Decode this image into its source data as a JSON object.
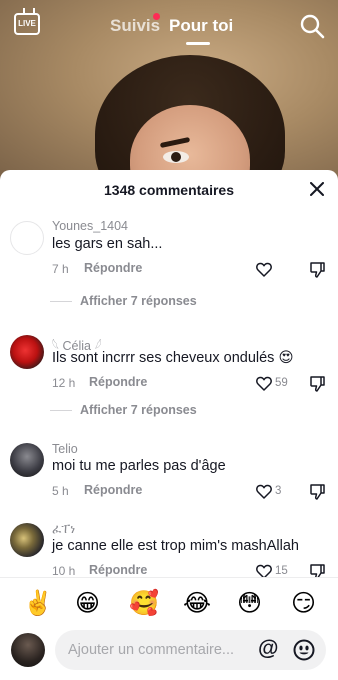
{
  "top_nav": {
    "live_label": "LIVE",
    "following_label": "Suivis",
    "foryou_label": "Pour toi"
  },
  "sheet": {
    "title": "1348 commentaires"
  },
  "comments": [
    {
      "username": "Younes_1404",
      "text": "les gars en sah...",
      "time": "7 h",
      "reply_label": "Répondre",
      "likes": "",
      "view_replies": "Afficher 7 réponses"
    },
    {
      "username": "𓆩 Célia 𓆪",
      "text": "Ils sont incrrr ses cheveux ondulés 😍",
      "time": "12 h",
      "reply_label": "Répondre",
      "likes": "59",
      "view_replies": "Afficher 7 réponses"
    },
    {
      "username": "Telio",
      "text": "moi tu me parles pas d'âge",
      "time": "5 h",
      "reply_label": "Répondre",
      "likes": "3"
    },
    {
      "username": "ፈፐነ",
      "text": "je canne elle est trop mim's mashAllah",
      "time": "10 h",
      "reply_label": "Répondre",
      "likes": "15"
    }
  ],
  "quick_emojis": [
    "✌️",
    "😁",
    "🥰",
    "😂",
    "😳",
    "😏"
  ],
  "input": {
    "placeholder": "Ajouter un commentaire...",
    "at_symbol": "@"
  },
  "colors": {
    "accent": "#fe2c55",
    "text_primary": "#161823",
    "text_secondary": "#8a8b91"
  }
}
